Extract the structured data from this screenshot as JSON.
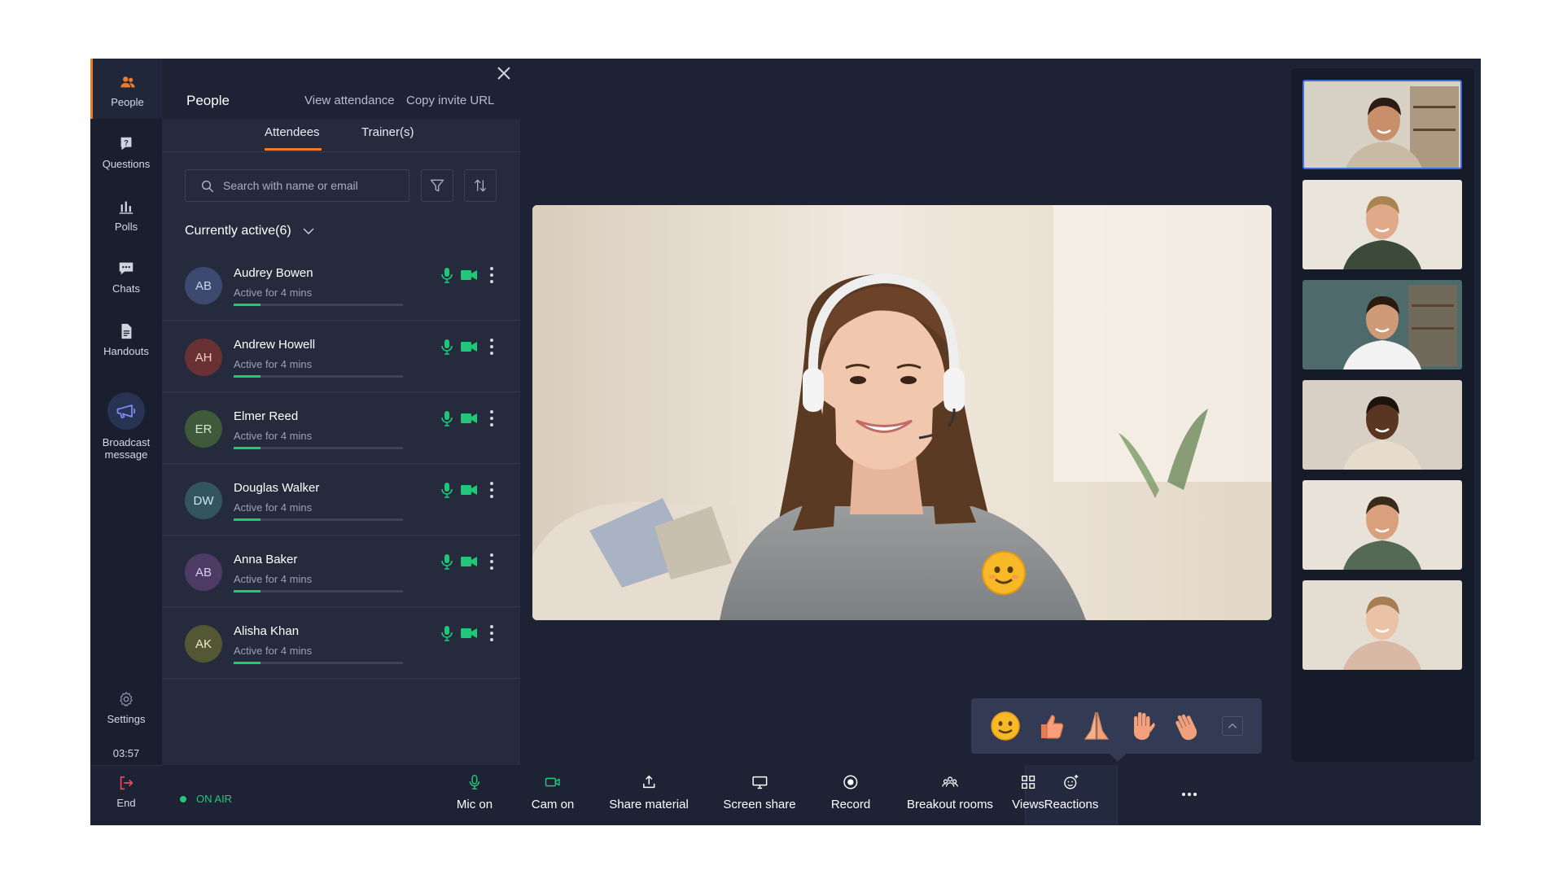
{
  "rail": {
    "people": "People",
    "questions": "Questions",
    "polls": "Polls",
    "chats": "Chats",
    "handouts": "Handouts",
    "broadcast_line1": "Broadcast",
    "broadcast_line2": "message",
    "settings": "Settings",
    "timer": "03:57",
    "end": "End"
  },
  "panel": {
    "title": "People",
    "view_attendance": "View attendance",
    "copy_invite": "Copy invite URL",
    "tabs": [
      "Attendees",
      "Trainer(s)"
    ],
    "search_placeholder": "Search with name or email",
    "section": "Currently active(6)",
    "people": [
      {
        "initials": "AB",
        "name": "Audrey Bowen",
        "status": "Active for 4 mins",
        "avatar_bg": "#3b4a6e",
        "avatar_fg": "#c9d4f0",
        "progress": 0.16
      },
      {
        "initials": "AH",
        "name": "Andrew Howell",
        "status": "Active for 4 mins",
        "avatar_bg": "#6a3135",
        "avatar_fg": "#f0c9c9",
        "progress": 0.16
      },
      {
        "initials": "ER",
        "name": "Elmer Reed",
        "status": "Active for 4 mins",
        "avatar_bg": "#3e5a3a",
        "avatar_fg": "#cfeac9",
        "progress": 0.16
      },
      {
        "initials": "DW",
        "name": "Douglas Walker",
        "status": "Active for 4 mins",
        "avatar_bg": "#33555e",
        "avatar_fg": "#c9e6ec",
        "progress": 0.16
      },
      {
        "initials": "AB",
        "name": "Anna Baker",
        "status": "Active for 4 mins",
        "avatar_bg": "#4e3b63",
        "avatar_fg": "#dccbef",
        "progress": 0.16
      },
      {
        "initials": "AK",
        "name": "Alisha Khan",
        "status": "Active for 4 mins",
        "avatar_bg": "#545734",
        "avatar_fg": "#ecefc9",
        "progress": 0.16
      }
    ]
  },
  "bottombar": {
    "onair": "ON AIR",
    "tools": [
      "Mic on",
      "Cam on",
      "Share material",
      "Screen share",
      "Record",
      "Breakout rooms",
      "Views",
      "Reactions"
    ]
  },
  "colors": {
    "accent": "#f07a2a",
    "active_green": "#22c77a",
    "selected_thumb": "#3f6de0"
  }
}
